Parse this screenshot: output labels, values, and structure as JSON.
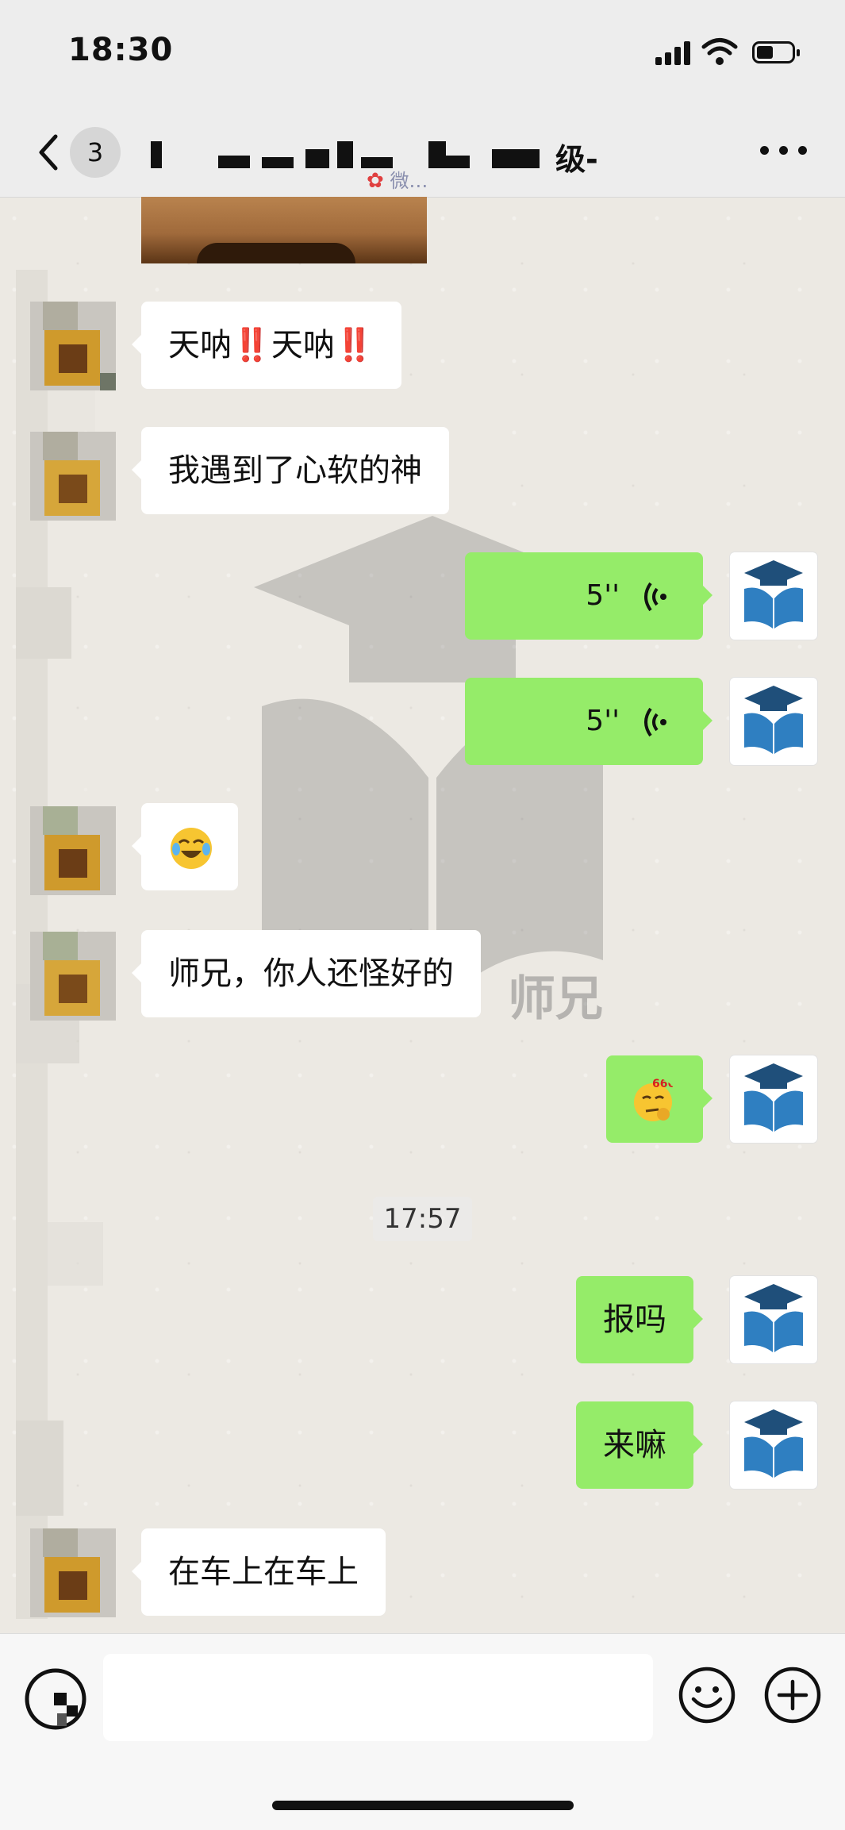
{
  "status_bar": {
    "time": "18:30"
  },
  "nav": {
    "unread_count": "3",
    "title_visible": "级-"
  },
  "overlap_text": "微…",
  "watermark": {
    "text": "师兄"
  },
  "timestamp": "17:57",
  "messages": [
    {
      "side": "in",
      "text_parts": [
        "天呐",
        "‼️",
        "天呐",
        "‼️"
      ]
    },
    {
      "side": "in",
      "text": "我遇到了心软的神"
    },
    {
      "side": "out",
      "type": "voice",
      "duration": "5''"
    },
    {
      "side": "out",
      "type": "voice",
      "duration": "5''"
    },
    {
      "side": "in",
      "type": "emoji",
      "emoji": "crying-laughing"
    },
    {
      "side": "in",
      "text": "师兄，你人还怪好的"
    },
    {
      "side": "out",
      "type": "emoji",
      "emoji": "666-thinking",
      "emoji_text": "666"
    },
    {
      "side": "out",
      "text": "报吗"
    },
    {
      "side": "out",
      "text": "来嘛"
    },
    {
      "side": "in",
      "text": "在车上在车上"
    }
  ],
  "colors": {
    "outgoing_bubble": "#95ec69",
    "incoming_bubble": "#ffffff",
    "logo_blue": "#2f7fc1",
    "logo_dark": "#1f4f7a"
  }
}
